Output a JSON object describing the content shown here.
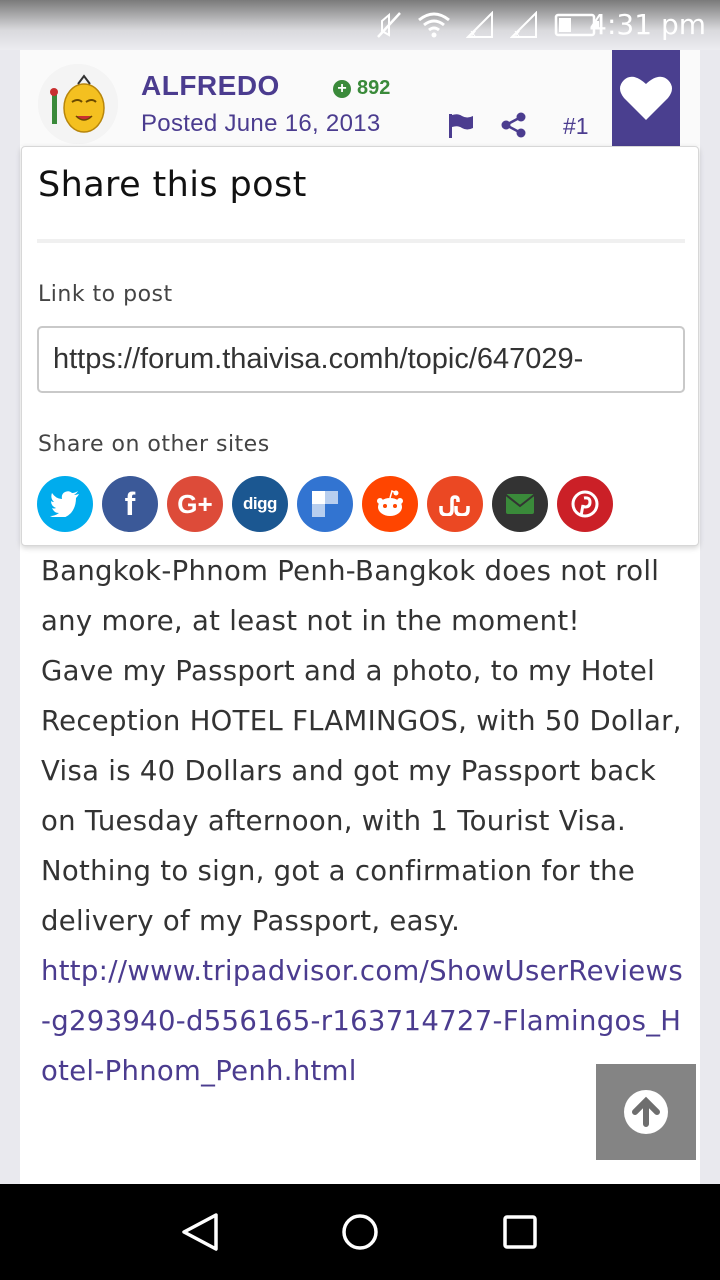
{
  "status_bar": {
    "time": "4:31 pm",
    "icons": [
      "mute-icon",
      "wifi-icon",
      "signal-1-icon",
      "signal-2-icon",
      "battery-icon"
    ]
  },
  "post": {
    "author": "ALFREDO",
    "reputation": "892",
    "posted": "Posted June 16, 2013",
    "post_number": "#1",
    "body_paragraphs": [
      "Bangkok-Phnom Penh-Bangkok does not roll any more, at least not in the moment!",
      "Gave my Passport and a photo, to my Hotel Reception HOTEL FLAMINGOS, with 50 Dollar, Visa is 40 Dollars and got my Passport back on Tuesday afternoon, with 1 Tourist Visa. Nothing to sign, got a confirmation for the delivery of my Passport, easy."
    ],
    "link_text": "http://www.tripadvisor.com/ShowUserReviews-g293940-d556165-r163714727-Flamingos_Hotel-Phnom_Penh.html"
  },
  "share_popup": {
    "title": "Share this post",
    "link_label": "Link to post",
    "link_value": "https://forum.thaivisa.comh/topic/647029-",
    "other_sites_label": "Share on other sites",
    "sites": [
      {
        "name": "twitter",
        "color": "#00aced",
        "glyph": "t"
      },
      {
        "name": "facebook",
        "color": "#3b5998",
        "glyph": "f"
      },
      {
        "name": "google-plus",
        "color": "#dd4b39",
        "glyph": "G+"
      },
      {
        "name": "digg",
        "color": "#1b5791",
        "glyph": "digg"
      },
      {
        "name": "delicious",
        "color": "#3274d1",
        "glyph": ""
      },
      {
        "name": "reddit",
        "color": "#ff4500",
        "glyph": ""
      },
      {
        "name": "stumbleupon",
        "color": "#eb4823",
        "glyph": "su"
      },
      {
        "name": "email",
        "color": "#333333",
        "glyph": ""
      },
      {
        "name": "pinterest",
        "color": "#cb2027",
        "glyph": "p"
      }
    ]
  },
  "colors": {
    "accent": "#4a3f8f",
    "link": "#4b3c8f",
    "reputation": "#3a8a3a"
  }
}
